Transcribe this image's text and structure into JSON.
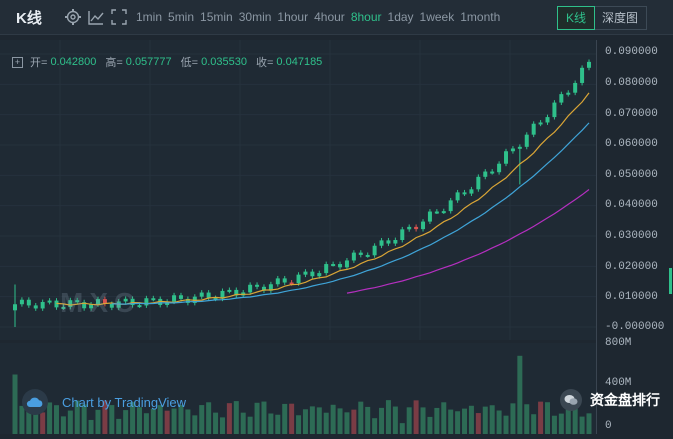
{
  "toolbar": {
    "title": "K线",
    "intervals": [
      "1min",
      "5min",
      "15min",
      "30min",
      "1hour",
      "4hour",
      "8hour",
      "1day",
      "1week",
      "1month"
    ],
    "active_interval": "8hour",
    "views": [
      "K线",
      "深度图"
    ],
    "active_view": "K线"
  },
  "ohlc": {
    "open_label": "开=",
    "open": "0.042800",
    "high_label": "高=",
    "high": "0.057777",
    "low_label": "低=",
    "low": "0.035530",
    "close_label": "收=",
    "close": "0.047185"
  },
  "price_axis": [
    "0.090000",
    "0.080000",
    "0.070000",
    "0.060000",
    "0.050000",
    "0.040000",
    "0.030000",
    "0.020000",
    "0.010000",
    "-0.000000"
  ],
  "volume_axis": [
    "800M",
    "400M",
    "0"
  ],
  "watermark": "MXC",
  "brand": "Chart by TradingView",
  "wechat": "资金盘排行",
  "colors": {
    "up": "#2fc08b",
    "down": "#d9534f",
    "ma1": "#d9a536",
    "ma2": "#3fa4d8",
    "ma3": "#b52fc0"
  }
}
